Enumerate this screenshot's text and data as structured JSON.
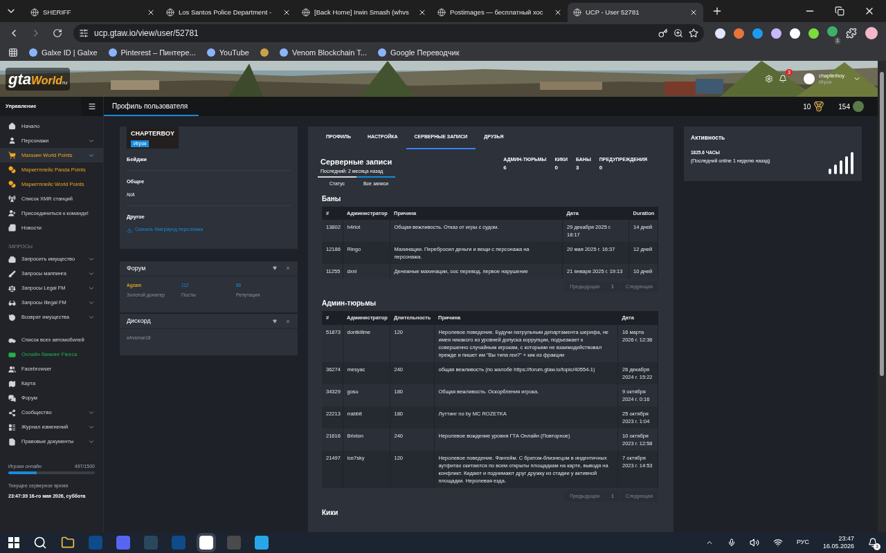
{
  "browser": {
    "tabs": [
      {
        "title": "SHERIFF",
        "selected": false
      },
      {
        "title": "Los Santos Police Department -",
        "selected": false
      },
      {
        "title": "[Back Home] Irwin Smash (whvs",
        "selected": false
      },
      {
        "title": "Postimages — бесплатный хос",
        "selected": false
      },
      {
        "title": "UCP - User 52781",
        "selected": true
      }
    ],
    "url": "ucp.gtaw.io/view/user/52781",
    "extension_badge": "1",
    "bookmarks": [
      {
        "kind": "link",
        "label": "Galxe ID | Galxe"
      },
      {
        "kind": "link",
        "label": "Pinterest – Пинтере..."
      },
      {
        "kind": "link",
        "label": "YouTube"
      },
      {
        "kind": "icon"
      },
      {
        "kind": "link",
        "label": "Venom Blockchain T..."
      },
      {
        "kind": "link",
        "label": "Google Переводчик"
      }
    ]
  },
  "site_header": {
    "logo": [
      "gta",
      "World",
      "ru"
    ],
    "notifications": "3",
    "user": {
      "name": "chapterboy",
      "role": "Игрок"
    }
  },
  "sidebar": {
    "title": "Управление",
    "sections": [
      {
        "items": [
          {
            "label": "Начало",
            "color": "#d1d5db",
            "expandable": false,
            "selected": false
          },
          {
            "label": "Персонажи",
            "color": "#d1d5db",
            "expandable": true,
            "selected": false
          },
          {
            "label": "Магазин World Points",
            "color": "#f5a623",
            "expandable": true,
            "selected": true
          },
          {
            "label": "Маркетплейс Panda Points",
            "color": "#f5a623",
            "expandable": false,
            "selected": false
          },
          {
            "label": "Маркетплейс World Points",
            "color": "#f5a623",
            "expandable": false,
            "selected": false
          },
          {
            "label": "Список XMR станций",
            "color": "#d1d5db",
            "expandable": false,
            "selected": false
          },
          {
            "label": "Присоединиться к команде!",
            "color": "#d1d5db",
            "expandable": false,
            "selected": false
          },
          {
            "label": "Новости",
            "color": "#d1d5db",
            "expandable": false,
            "selected": false
          }
        ]
      },
      {
        "label": "ЗАПРОСЫ",
        "items": [
          {
            "label": "Запросить имущество",
            "color": "#d1d5db",
            "expandable": true,
            "selected": false
          },
          {
            "label": "Запросы маппинга",
            "color": "#d1d5db",
            "expandable": true,
            "selected": false
          },
          {
            "label": "Запросы Legal FM",
            "color": "#d1d5db",
            "expandable": true,
            "selected": false
          },
          {
            "label": "Запросы Illegal FM",
            "color": "#d1d5db",
            "expandable": true,
            "selected": false
          },
          {
            "label": "Возврат имущества",
            "color": "#d1d5db",
            "expandable": true,
            "selected": false
          }
        ]
      },
      {
        "items": [
          {
            "label": "Список всех автомобилей",
            "color": "#d1d5db",
            "expandable": false,
            "selected": false
          },
          {
            "label": "Онлайн банкинг Fleeca",
            "color": "#22b04b",
            "expandable": false,
            "selected": false
          },
          {
            "label": "Facebrowser",
            "color": "#d1d5db",
            "expandable": false,
            "selected": false
          },
          {
            "label": "Карта",
            "color": "#d1d5db",
            "expandable": false,
            "selected": false
          },
          {
            "label": "Форум",
            "color": "#d1d5db",
            "expandable": false,
            "selected": false
          },
          {
            "label": "Сообщество",
            "color": "#d1d5db",
            "expandable": true,
            "selected": false
          },
          {
            "label": "Журнал изменений",
            "color": "#d1d5db",
            "expandable": true,
            "selected": false
          },
          {
            "label": "Правовые документы",
            "color": "#d1d5db",
            "expandable": true,
            "selected": false
          }
        ]
      }
    ],
    "online": {
      "label": "Игроки онлайн",
      "count": "497/1500",
      "level": 0.33
    },
    "server_time": {
      "label": "Текущее серверное время",
      "value": "23:47:39 16-го мая 2026, суббота"
    }
  },
  "page_title": "Профиль пользователя",
  "header_stats": [
    {
      "value": "10",
      "kind": "medal"
    },
    {
      "value": "154",
      "kind": "avatar"
    }
  ],
  "profile": {
    "name": "CHAPTERBOY",
    "rank": "Игрок",
    "sections": [
      {
        "title": "Бейджи"
      },
      {
        "title": "Общее",
        "text": "N/A"
      },
      {
        "title": "Другое",
        "link": "Скачать бекграунд персонажа"
      }
    ]
  },
  "forum": {
    "title": "Форум",
    "user": "Agzam",
    "user_role": "Золотой донатер",
    "stats": [
      {
        "value": "112",
        "label": "Посты"
      },
      {
        "value": "88",
        "label": "Репутация"
      }
    ]
  },
  "discord": {
    "title": "Дискорд",
    "user": "whvsman18"
  },
  "tabs": [
    {
      "label": "ПРОФИЛЬ",
      "selected": false
    },
    {
      "label": "НАСТРОЙКА",
      "selected": false
    },
    {
      "label": "СЕРВЕРНЫЕ ЗАПИСИ",
      "selected": true
    },
    {
      "label": "ДРУЗЬЯ",
      "selected": false
    }
  ],
  "records": {
    "title": "Серверные записи",
    "subtitle": "Последний: 2 месяца назад",
    "stats": [
      {
        "label": "АДМИН-ТЮРЬМЫ",
        "value": "6"
      },
      {
        "label": "КИКИ",
        "value": "0"
      },
      {
        "label": "БАНЫ",
        "value": "3"
      },
      {
        "label": "ПРЕДУПРЕЖДЕНИЯ",
        "value": "0"
      }
    ],
    "subtabs": [
      {
        "label": "Статус",
        "selected": false
      },
      {
        "label": "Все записи",
        "selected": true
      }
    ],
    "tables": [
      {
        "title": "Баны",
        "columns": [
          "#",
          "Администратор",
          "Причина",
          "Дата",
          "Duration"
        ],
        "rows": [
          [
            "13802",
            "h4rlot",
            "Общая вежливость. Отказ от игры с судом.",
            "29 декабря 2025 г. 18:17",
            "14 дней"
          ],
          [
            "12186",
            "Ringo",
            "Махинации. Перебросил деньги и вещи с персонажа на персонажа.",
            "20 мая 2025 г. 16:37",
            "12 дней"
          ],
          [
            "11255",
            "dxnl",
            "Денежные махинации, оос перевод, первое нарушение",
            "21 января 2025 г. 19:13",
            "10 дней"
          ]
        ],
        "pagination": [
          "Предыдущая",
          "1",
          "Следующая"
        ]
      },
      {
        "title": "Админ-тюрьмы",
        "columns": [
          "#",
          "Администратор",
          "Длительность",
          "Причина",
          "Дата"
        ],
        "rows": [
          [
            "51873",
            "dontkillme",
            "120",
            "Неролевое поведение. Будучи патрульным департамента шерифа, не имея никакого из уровней допуска коррупции, подъезжает к совершенно случайным игрокам, с которыми не взаимодействовал прежде и пишет им \"Вы типа геи?\" + кик из фракции",
            "16 марта 2026 г. 12:36"
          ],
          [
            "36274",
            "mesyac",
            "240",
            "общая вежливость (по жалобе https://forum.gtaw.io/topic/40554-1)",
            "26 декабря 2024 г. 15:22"
          ],
          [
            "34329",
            "gosu",
            "180",
            "Общая вежливость. Оскорбления игрока.",
            "9 октября 2024 г. 0:16"
          ],
          [
            "22213",
            "rrabbit",
            "180",
            "Луттинг no by MC ROZETKA",
            "25 октября 2023 г. 1:04"
          ],
          [
            "21616",
            "Brixton",
            "240",
            "Неролевое вождение уровня ГТА Онлайн (Повторное)",
            "10 октября 2023 г. 12:58"
          ],
          [
            "21497",
            "ice7sky",
            "120",
            "Неролевое поведение. Фангейм. С братом-близнецом в индентичных аутфитах скитаются по всем открыты площадкам на карте, выводя на конфликт. Кидают и поднимают друг дружку из стадии у активной площадки. Неролевая езда.",
            "7 октября 2023 г. 14:53"
          ]
        ],
        "pagination": [
          "Предыдущая",
          "1",
          "Следующая"
        ]
      }
    ],
    "next_title": "Кики"
  },
  "activity": {
    "title": "Активность",
    "hours": "1825.6 ЧАСЫ",
    "last_online": "(Последний online 1 неделю назад)"
  },
  "taskbar": {
    "language": "РУС",
    "time": "23:47",
    "date": "16.05.2026",
    "notifications": "3"
  }
}
